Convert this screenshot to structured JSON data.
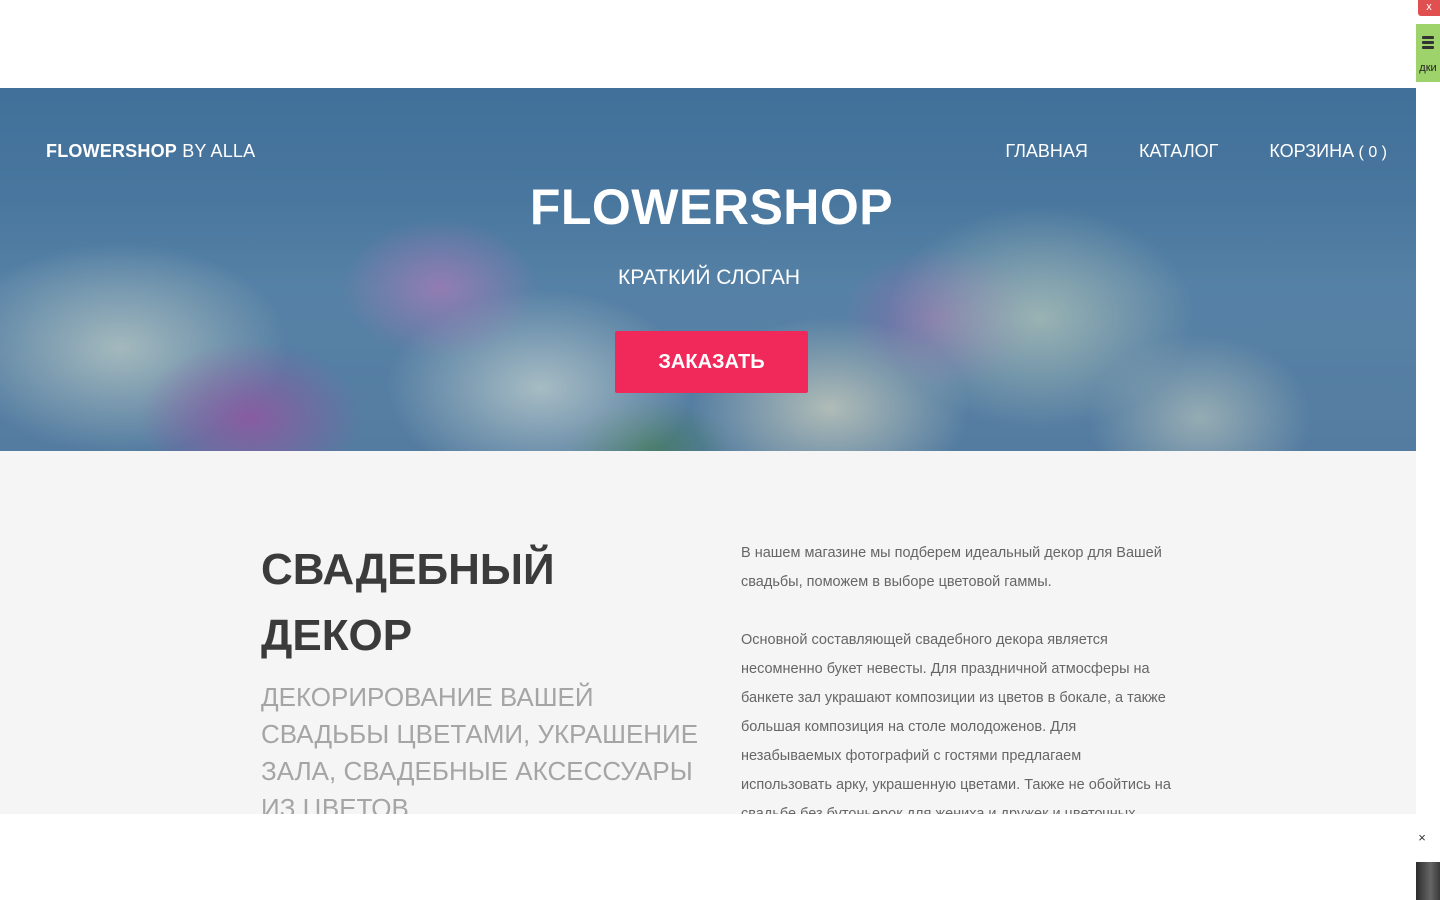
{
  "header": {
    "brand_bold": "FLOWERSHOP",
    "brand_light": " BY ALLA",
    "nav": {
      "home": "ГЛАВНАЯ",
      "catalog": "КАТАЛОГ",
      "cart": "КОРЗИНА",
      "cart_count": " ( 0 )"
    }
  },
  "hero": {
    "title": "FLOWERSHOP",
    "slogan": "КРАТКИЙ СЛОГАН",
    "cta": "ЗАКАЗАТЬ",
    "cta_color": "#f1295a"
  },
  "section": {
    "title": "СВАДЕБНЫЙ ДЕКОР",
    "subtitle": "ДЕКОРИРОВАНИЕ ВАШЕЙ СВАДЬБЫ ЦВЕТАМИ, УКРАШЕНИЕ ЗАЛА, СВАДЕБНЫЕ АКСЕССУАРЫ ИЗ ЦВЕТОВ",
    "paragraph_1": "В нашем магазине мы подберем идеальный декор для Вашей свадьбы, поможем в выборе цветовой гаммы.",
    "paragraph_2": "Основной составляющей свадебного декора является несомненно букет невесты. Для праздничной атмосферы на банкете зал украшают композиции из цветов в бокале, а также большая композиция на столе молодоженов. Для незабываемых фотографий с гостями предлагаем использовать арку, украшенную цветами. Также не обойтись на свадьбе без бутоньерок для жениха и дружек и цветочных"
  },
  "browser": {
    "side_label": "дки",
    "close_glyph": "×",
    "top_close_glyph": "x"
  },
  "icons": {
    "menu": "hamburger-menu-icon",
    "close": "close-icon",
    "scroll_up": "chevron-up-icon",
    "scroll_down": "chevron-down-icon"
  }
}
